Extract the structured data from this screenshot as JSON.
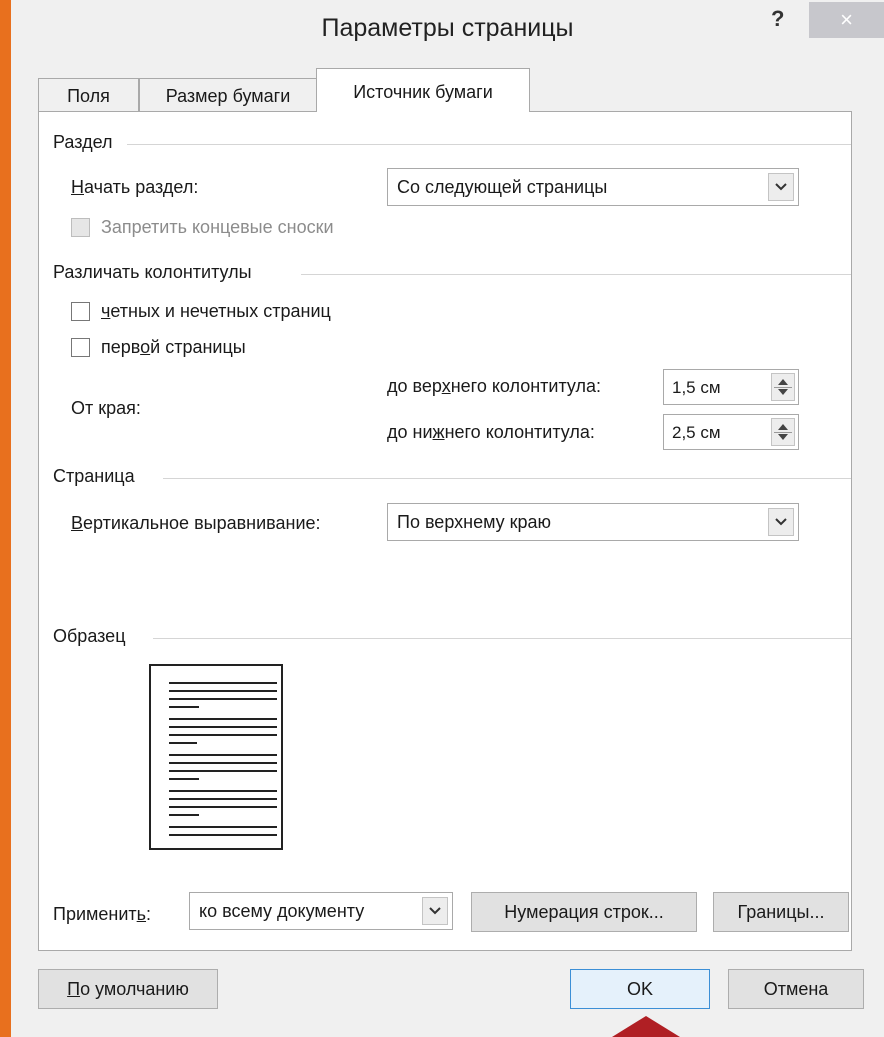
{
  "dialog": {
    "title": "Параметры страницы",
    "help": "?",
    "close": "×"
  },
  "tabs": [
    {
      "label": "Поля"
    },
    {
      "label": "Размер бумаги"
    },
    {
      "label": "Источник бумаги"
    }
  ],
  "section_razdel": {
    "heading": "Раздел",
    "start_label": "Начать раздел:",
    "start_value": "Со следующей страницы",
    "suppress_endnotes": {
      "label": "Запретить концевые сноски",
      "checked": false,
      "enabled": false
    }
  },
  "section_headers": {
    "heading": "Различать колонтитулы",
    "odd_even": {
      "label": "четных и нечетных страниц",
      "checked": false
    },
    "first_page": {
      "label": "первой страницы",
      "checked": false
    },
    "from_edge_label": "От края:",
    "header": {
      "label": "до верхнего колонтитула:",
      "value": "1,5 см"
    },
    "footer": {
      "label": "до нижнего колонтитула:",
      "value": "2,5 см"
    }
  },
  "section_page": {
    "heading": "Страница",
    "valign_label": "Вертикальное выравнивание:",
    "valign_value": "По верхнему краю"
  },
  "preview": {
    "heading": "Образец"
  },
  "apply": {
    "label": "Применить:",
    "value": "ко всему документу",
    "line_numbers_button": "Нумерация строк...",
    "borders_button": "Границы..."
  },
  "footer": {
    "default_button": "По умолчанию",
    "ok_button": "OK",
    "cancel_button": "Отмена"
  },
  "colors": {
    "accent_strip": "#e8701e",
    "pointer": "#b01f24",
    "ok_border": "#3c8fd6"
  }
}
